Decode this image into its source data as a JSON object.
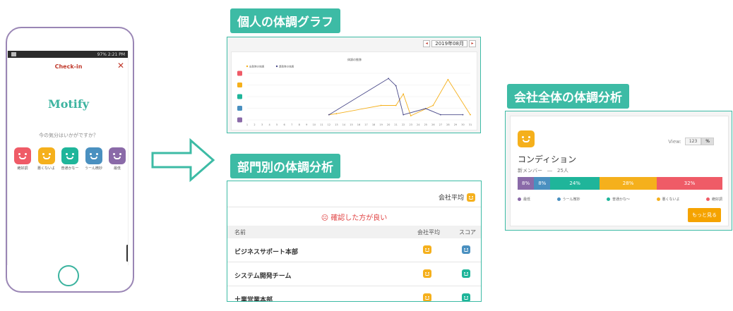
{
  "colors": {
    "teal": "#3dbba5",
    "best_red": "#ef5b67",
    "bad_orange": "#f5b01c",
    "normal_green": "#1fb59a",
    "meh_blue": "#4a90c0",
    "worst_purple": "#8a6aa8"
  },
  "phone": {
    "status": "97%  2:21 PM",
    "title": "Check-in",
    "close_icon": "close-icon",
    "logo": "Motify",
    "question": "今の気分はいかがですか？",
    "moods": [
      {
        "label": "絶好調",
        "color": "#ef5b67",
        "icon": "grin-face-icon"
      },
      {
        "label": "悪くないよ",
        "color": "#f5b01c",
        "icon": "smile-face-icon"
      },
      {
        "label": "普通かなー",
        "color": "#1fb59a",
        "icon": "neutral-face-icon"
      },
      {
        "label": "うーん微妙",
        "color": "#4a90c0",
        "icon": "meh-face-icon"
      },
      {
        "label": "最低",
        "color": "#8a6aa8",
        "icon": "dead-face-icon"
      }
    ]
  },
  "sections": {
    "personal": "個人の体調グラフ",
    "department": "部門別の体調分析",
    "company": "会社全体の体調分析"
  },
  "graph": {
    "month": "2019年08月",
    "prev_icon": "chevron-left-icon",
    "next_icon": "chevron-right-icon",
    "chart_data": {
      "type": "line",
      "title": "体調の推移",
      "x": [
        1,
        2,
        3,
        4,
        5,
        6,
        7,
        8,
        9,
        10,
        11,
        12,
        13,
        14,
        15,
        16,
        17,
        18,
        19,
        20,
        21,
        22,
        23,
        24,
        25,
        26,
        27,
        28,
        29,
        30,
        31
      ],
      "y_levels": [
        "絶好調",
        "悪くないよ",
        "普通かなー",
        "うーん微妙",
        "最低"
      ],
      "series": [
        {
          "name": "出勤時の体調",
          "color": "#f5b01c",
          "points": [
            [
              12,
              1.0
            ],
            [
              13,
              1.1
            ],
            [
              19,
              1.9
            ],
            [
              21,
              1.9
            ],
            [
              22,
              3.0
            ],
            [
              23,
              0.9
            ],
            [
              26,
              1.9
            ],
            [
              28,
              4.4
            ],
            [
              31,
              1.0
            ]
          ]
        },
        {
          "name": "退勤時の体調",
          "color": "#4a4a8a",
          "points": [
            [
              12,
              1.0
            ],
            [
              20,
              4.5
            ],
            [
              21,
              3.8
            ],
            [
              22,
              1.0
            ],
            [
              25,
              1.6
            ],
            [
              27,
              1.0
            ],
            [
              30,
              1.0
            ]
          ]
        }
      ]
    }
  },
  "dept": {
    "company_avg_label": "会社平均",
    "warning": "確認した方が良い",
    "col_name": "名前",
    "col_avg": "会社平均",
    "col_score": "スコア",
    "rows": [
      {
        "name": "ビジネスサポート本部",
        "avg_color": "#f5b01c",
        "score_color": "#4a90c0"
      },
      {
        "name": "システム開発チーム",
        "avg_color": "#f5b01c",
        "score_color": "#1fb59a"
      },
      {
        "name": "土業営業本部",
        "avg_color": "#f5b01c",
        "score_color": "#1fb59a"
      }
    ]
  },
  "company": {
    "view_label": "View:",
    "view_options": [
      "123",
      "%"
    ],
    "title": "コンディション",
    "new_members": "新メンバー　―　25人",
    "segments": [
      {
        "label": "8%",
        "value": 8,
        "color": "#8a6aa8"
      },
      {
        "label": "8%",
        "value": 8,
        "color": "#4a90c0"
      },
      {
        "label": "24%",
        "value": 24,
        "color": "#1fb59a"
      },
      {
        "label": "28%",
        "value": 28,
        "color": "#f5b01c"
      },
      {
        "label": "32%",
        "value": 32,
        "color": "#ef5b67"
      }
    ],
    "legend": [
      {
        "label": "最低",
        "color": "#8a6aa8"
      },
      {
        "label": "うーん微妙",
        "color": "#4a90c0"
      },
      {
        "label": "普通かな～",
        "color": "#1fb59a"
      },
      {
        "label": "悪くないよ",
        "color": "#f5b01c"
      },
      {
        "label": "絶好調",
        "color": "#ef5b67"
      }
    ],
    "more_button": "もっと見る"
  }
}
